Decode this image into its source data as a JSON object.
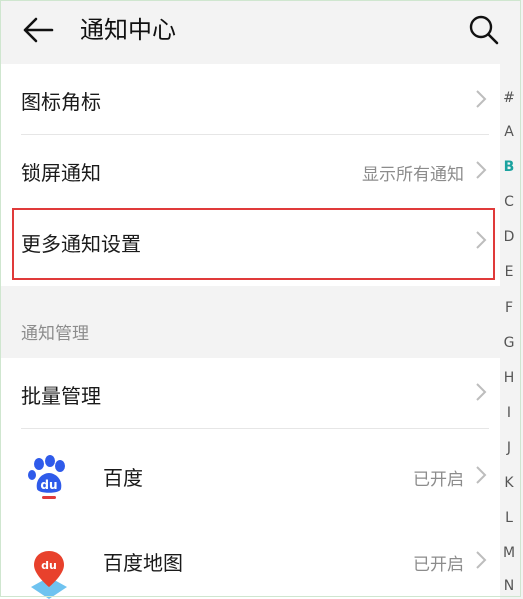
{
  "header": {
    "title": "通知中心",
    "back_icon": "back-arrow-icon",
    "search_icon": "search-icon"
  },
  "settings": {
    "icon_badge": "图标角标",
    "lockscreen": {
      "label": "锁屏通知",
      "value": "显示所有通知"
    },
    "more": "更多通知设置"
  },
  "section": {
    "label": "通知管理"
  },
  "batch": "批量管理",
  "apps": [
    {
      "name": "百度",
      "status": "已开启",
      "icon": "baidu-paw-icon"
    },
    {
      "name": "百度地图",
      "status": "已开启",
      "icon": "baidu-map-icon"
    }
  ],
  "index_bar": [
    "#",
    "A",
    "B",
    "C",
    "D",
    "E",
    "F",
    "G",
    "H",
    "I",
    "J",
    "K",
    "L",
    "M",
    "N"
  ],
  "index_active": "B",
  "colors": {
    "accent": "#1aa29f",
    "highlight": "#e03a3a",
    "baidu_blue": "#2f5bea",
    "map_red": "#e8412c"
  }
}
